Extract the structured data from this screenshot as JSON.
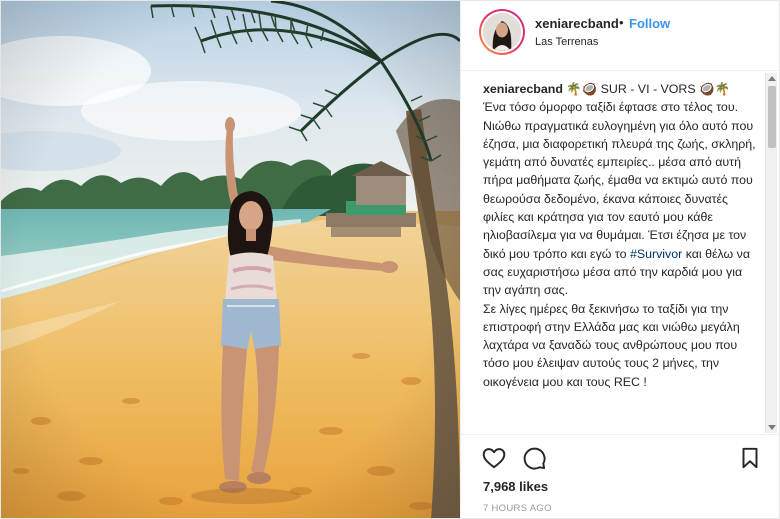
{
  "header": {
    "username": "xeniarecband",
    "separator": "•",
    "follow_label": "Follow",
    "location": "Las Terrenas"
  },
  "caption": {
    "username": "xeniarecband",
    "headline": " 🌴🥥 SUR - VI - VORS 🥥🌴",
    "text_before_hashtag": "Ένα τόσο όμορφο ταξίδι έφτασε στο τέλος του. Νιώθω πραγματικά ευλογημένη για όλο αυτό που έζησα, μια διαφορετική πλευρά της ζωής, σκληρή, γεμάτη από δυνατές εμπειρίες.. μέσα από αυτή πήρα μαθήματα ζωής, έμαθα να εκτιμώ αυτό που θεωρούσα δεδομένο, έκανα κάποιες δυνατές φιλίες και κράτησα για τον εαυτό μου κάθε ηλιοβασίλεμα για να θυμάμαι. Έτσι έζησα με τον δικό μου τρόπο και εγώ το ",
    "hashtag": "#Survivor",
    "text_after_hashtag": " και θέλω να σας ευχαριστήσω μέσα από την καρδιά μου για την αγάπη σας.\nΣε λίγες ημέρες θα ξεκινήσω το ταξίδι για την επιστροφή στην Ελλάδα μας και νιώθω μεγάλη λαχτάρα να ξαναδώ τους ανθρώπους μου που τόσο μου έλειψαν αυτούς τους 2 μήνες, την οικογένεια μου και τους REC !"
  },
  "actions": {
    "icons": [
      "heart-icon",
      "comment-icon",
      "bookmark-icon"
    ]
  },
  "likes": "7,968 likes",
  "timestamp": "7 HOURS AGO",
  "colors": {
    "follow": "#3897f0",
    "hashtag": "#003569",
    "timestamp": "#999999"
  }
}
